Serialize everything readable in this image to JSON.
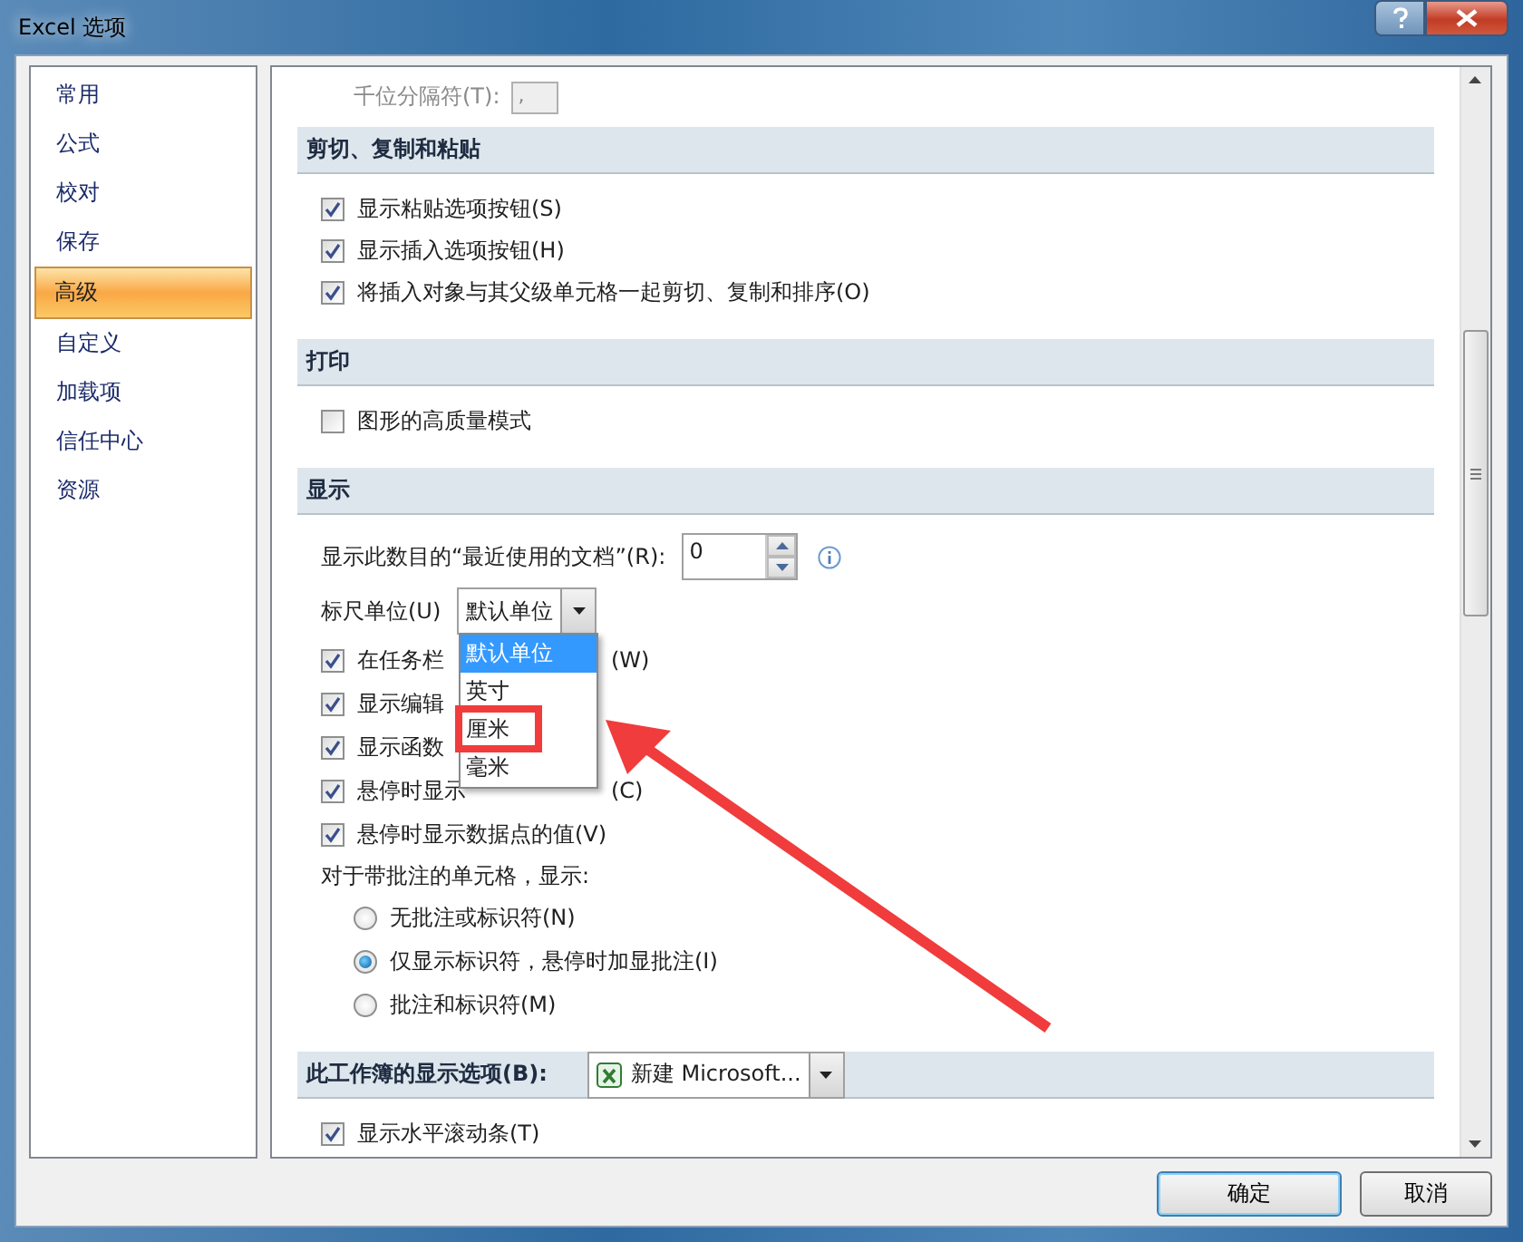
{
  "window": {
    "title": "Excel 选项"
  },
  "sidebar": {
    "items": [
      {
        "label": "常用",
        "selected": false
      },
      {
        "label": "公式",
        "selected": false
      },
      {
        "label": "校对",
        "selected": false
      },
      {
        "label": "保存",
        "selected": false
      },
      {
        "label": "高级",
        "selected": true
      },
      {
        "label": "自定义",
        "selected": false
      },
      {
        "label": "加载项",
        "selected": false
      },
      {
        "label": "信任中心",
        "selected": false
      },
      {
        "label": "资源",
        "selected": false
      }
    ]
  },
  "top_field": {
    "label": "千位分隔符(T):",
    "value": ",",
    "disabled": true
  },
  "sections": [
    {
      "title": "剪切、复制和粘贴",
      "rows": [
        {
          "kind": "checkbox",
          "label": "显示粘贴选项按钮(S)",
          "checked": true
        },
        {
          "kind": "checkbox",
          "label": "显示插入选项按钮(H)",
          "checked": true
        },
        {
          "kind": "checkbox",
          "label": "将插入对象与其父级单元格一起剪切、复制和排序(O)",
          "checked": true
        }
      ]
    },
    {
      "title": "打印",
      "rows": [
        {
          "kind": "checkbox",
          "label": "图形的高质量模式",
          "checked": false
        }
      ]
    },
    {
      "title": "显示",
      "rows": [
        {
          "kind": "spinner",
          "label": "显示此数目的“最近使用的文档”(R):",
          "value": "0"
        },
        {
          "kind": "combo",
          "label": "标尺单位(U)",
          "value": "默认单位",
          "expanded": true,
          "options": [
            {
              "label": "默认单位",
              "selected": true,
              "highlighted": false
            },
            {
              "label": "英寸",
              "selected": false,
              "highlighted": false
            },
            {
              "label": "厘米",
              "selected": false,
              "highlighted": true
            },
            {
              "label": "毫米",
              "selected": false,
              "highlighted": false
            }
          ]
        },
        {
          "kind": "checkbox",
          "label": "在任务栏",
          "label_tail": "(W)",
          "checked": true
        },
        {
          "kind": "checkbox",
          "label": "显示编辑",
          "checked": true
        },
        {
          "kind": "checkbox",
          "label": "显示函数",
          "checked": true
        },
        {
          "kind": "checkbox",
          "label": "悬停时显示",
          "label_tail": "(C)",
          "checked": true
        },
        {
          "kind": "checkbox",
          "label": "悬停时显示数据点的值(V)",
          "checked": true
        },
        {
          "kind": "text",
          "label": "对于带批注的单元格，显示:"
        },
        {
          "kind": "radio",
          "label": "无批注或标识符(N)",
          "selected": false
        },
        {
          "kind": "radio",
          "label": "仅显示标识符，悬停时加显批注(I)",
          "selected": true
        },
        {
          "kind": "radio",
          "label": "批注和标识符(M)",
          "selected": false
        }
      ]
    },
    {
      "title": "此工作簿的显示选项(B):",
      "combo": {
        "value": "新建 Microsoft..."
      },
      "rows": [
        {
          "kind": "checkbox",
          "label": "显示水平滚动条(T)",
          "checked": true
        }
      ]
    }
  ],
  "buttons": [
    {
      "label": "确定",
      "default": true
    },
    {
      "label": "取消",
      "default": false
    }
  ],
  "arrow_annotation": true
}
